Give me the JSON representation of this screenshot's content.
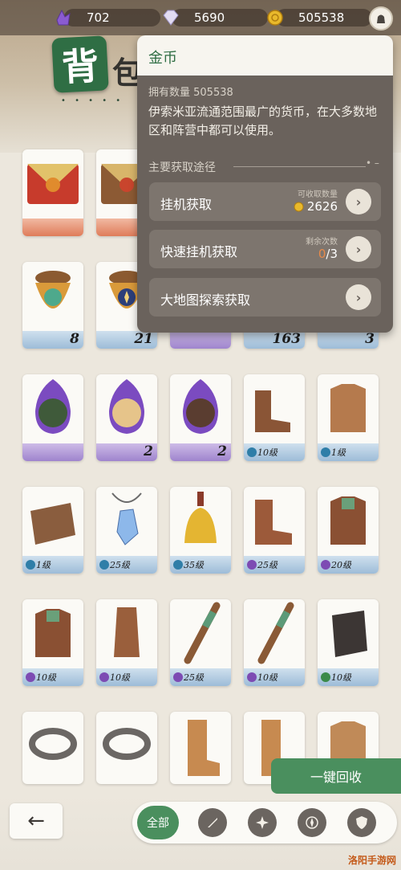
{
  "currencies": [
    {
      "name": "purple-crystal",
      "value": "702",
      "icon": "purple-crystal-icon"
    },
    {
      "name": "diamond",
      "value": "5690",
      "icon": "diamond-icon"
    },
    {
      "name": "gold",
      "value": "505538",
      "icon": "gold-coin-icon"
    }
  ],
  "header": {
    "title_badge": "背",
    "title_rest": "包",
    "dots": "• • • • •"
  },
  "popup": {
    "title": "金币",
    "owned": "拥有数量 505538",
    "description": "伊索米亚流通范围最广的货币，在大多数地区和阵营中都可以使用。",
    "section": "主要获取途径",
    "routes": [
      {
        "label": "挂机获取",
        "meta": "可收取数量",
        "value": "2626",
        "value_prefix": ""
      },
      {
        "label": "快速挂机获取",
        "meta": "剩余次数",
        "value": "/3",
        "value_prefix": "0"
      },
      {
        "label": "大地图探索获取",
        "meta": "",
        "value": "",
        "value_prefix": ""
      }
    ]
  },
  "items": {
    "row1": [
      {
        "count": ""
      },
      {
        "count": ""
      }
    ],
    "row2": [
      {
        "count": "8"
      },
      {
        "count": "21"
      },
      {
        "count": ""
      },
      {
        "count": "163"
      },
      {
        "count": "3"
      }
    ],
    "row3": [
      {
        "count": ""
      },
      {
        "count": "2"
      },
      {
        "count": "2"
      },
      {
        "level": "10级"
      },
      {
        "level": "1级"
      }
    ],
    "row4": [
      {
        "level": "1级"
      },
      {
        "level": "25级"
      },
      {
        "level": "35级"
      },
      {
        "level": "25级"
      },
      {
        "level": "20级"
      }
    ],
    "row5": [
      {
        "level": "10级"
      },
      {
        "level": "10级"
      },
      {
        "level": "25级"
      },
      {
        "level": "10级"
      },
      {
        "level": "10级"
      }
    ]
  },
  "buttons": {
    "recycle": "一键回收",
    "back": "←",
    "filter_all": "全部"
  },
  "filters": [
    "weapon-filter-icon",
    "star-filter-icon",
    "compass-filter-icon",
    "shield-filter-icon"
  ],
  "watermark": "洛阳手游网"
}
